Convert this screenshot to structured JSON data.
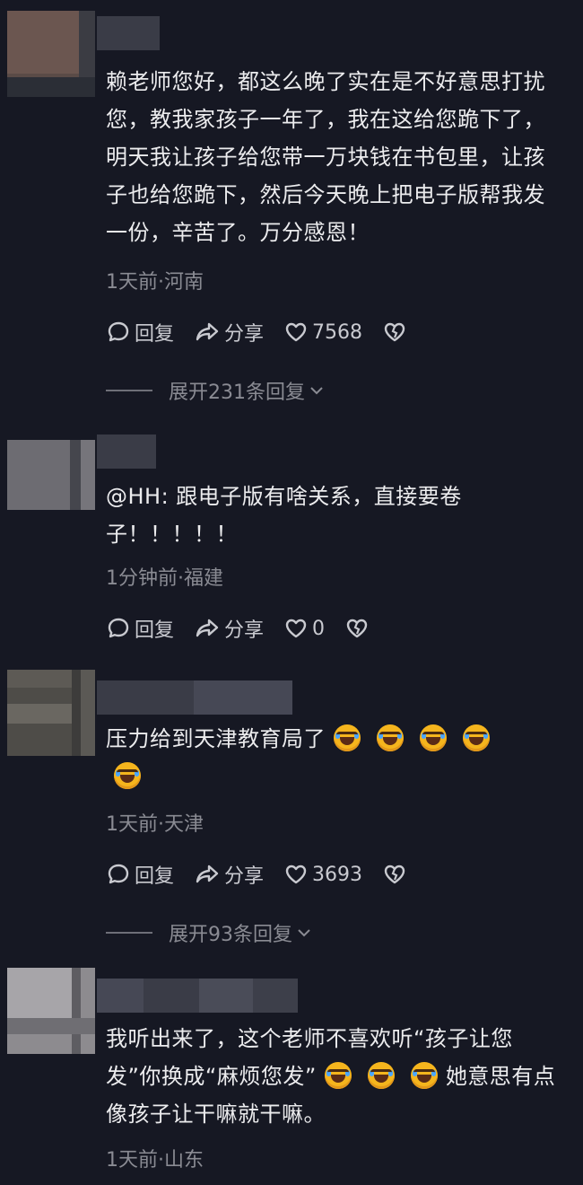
{
  "comments": [
    {
      "text": "赖老师您好，都这么晚了实在是不好意思打扰您，教我家孩子一年了，我在这给您跪下了，明天我让孩子给您带一万块钱在书包里，让孩子也给您跪下，然后今天晚上把电子版帮我发一份，辛苦了。万分感恩！",
      "meta": "1天前·河南",
      "reply_label": "回复",
      "share_label": "分享",
      "like_count": "7568",
      "expand_label": "展开231条回复"
    },
    {
      "text": "@HH: 跟电子版有啥关系，直接要卷子！！！！！",
      "meta": "1分钟前·福建",
      "reply_label": "回复",
      "share_label": "分享",
      "like_count": "0"
    },
    {
      "text": "压力给到天津教育局了",
      "meta": "1天前·天津",
      "reply_label": "回复",
      "share_label": "分享",
      "like_count": "3693",
      "expand_label": "展开93条回复"
    },
    {
      "text_a": "我听出来了，这个老师不喜欢听“孩子让您发”你换成“麻烦您发”",
      "text_b": "她意思有点像孩子让干嘛就干嘛。",
      "meta": "1天前·山东"
    }
  ],
  "colors": {
    "background": "#161823",
    "text": "#ececee",
    "muted": "#8a8b93",
    "emoji": "#f5b51d"
  },
  "icons": [
    "comment-bubble-icon",
    "share-arrow-icon",
    "heart-icon",
    "broken-heart-icon",
    "chevron-down-icon",
    "laugh-cry-emoji"
  ]
}
